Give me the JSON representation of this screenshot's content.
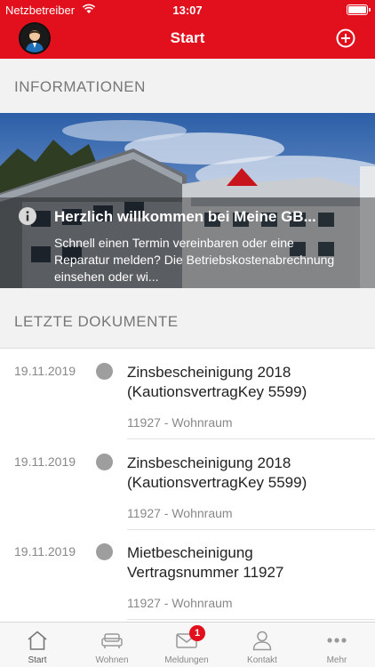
{
  "status_bar": {
    "carrier": "Netzbetreiber",
    "time": "13:07"
  },
  "header": {
    "title": "Start"
  },
  "sections": {
    "info_title": "INFORMATIONEN",
    "docs_title": "LETZTE DOKUMENTE"
  },
  "banner": {
    "title": "Herzlich willkommen bei Meine GB...",
    "text": "Schnell einen Termin vereinbaren oder eine Reparatur melden? Die Betriebskostenabrechnung einsehen oder wi..."
  },
  "documents": [
    {
      "date": "19.11.2019",
      "title": "Zinsbescheinigung 2018 (KautionsvertragKey 5599)",
      "subtitle": "11927 - Wohnraum"
    },
    {
      "date": "19.11.2019",
      "title": "Zinsbescheinigung 2018 (KautionsvertragKey 5599)",
      "subtitle": "11927 - Wohnraum"
    },
    {
      "date": "19.11.2019",
      "title": "Mietbescheinigung Vertragsnummer 11927",
      "subtitle": "11927 - Wohnraum"
    }
  ],
  "tabs": [
    {
      "label": "Start",
      "icon": "home-icon"
    },
    {
      "label": "Wohnen",
      "icon": "sofa-icon"
    },
    {
      "label": "Meldungen",
      "icon": "mail-icon",
      "badge": "1"
    },
    {
      "label": "Kontakt",
      "icon": "person-icon"
    },
    {
      "label": "Mehr",
      "icon": "more-icon"
    }
  ],
  "colors": {
    "brand": "#e2101c",
    "tab_inactive": "#888888"
  }
}
